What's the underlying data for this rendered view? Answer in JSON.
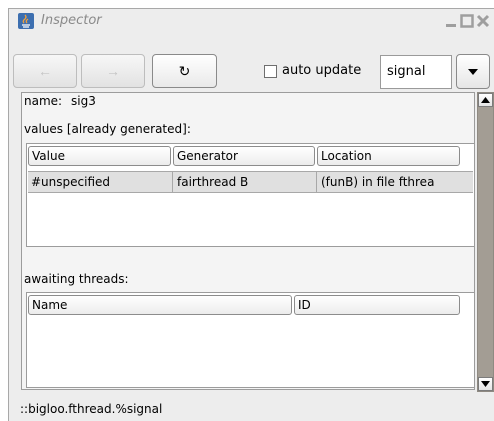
{
  "window": {
    "title": "Inspector",
    "icon": "java-icon"
  },
  "toolbar": {
    "back_icon": "←",
    "forward_icon": "→",
    "refresh_icon": "↻",
    "auto_update_label": "auto update",
    "auto_update_checked": false,
    "type_value": "signal"
  },
  "details": {
    "name_label": "name:",
    "name_value": "sig3",
    "values_title": "values [already generated]:",
    "values_table": {
      "columns": [
        "Value",
        "Generator",
        "Location"
      ],
      "rows": [
        [
          "#unspecified",
          "fairthread B",
          "(funB) in file fthrea"
        ]
      ]
    },
    "threads_title": "awaiting threads:",
    "threads_table": {
      "columns": [
        "Name",
        "ID"
      ],
      "rows": []
    }
  },
  "status_text": "::bigloo.fthread.%signal",
  "colors": {
    "window_bg": "#ededed",
    "scrollbar_track": "#a39d94",
    "selected_row": "#e0e0e0"
  }
}
